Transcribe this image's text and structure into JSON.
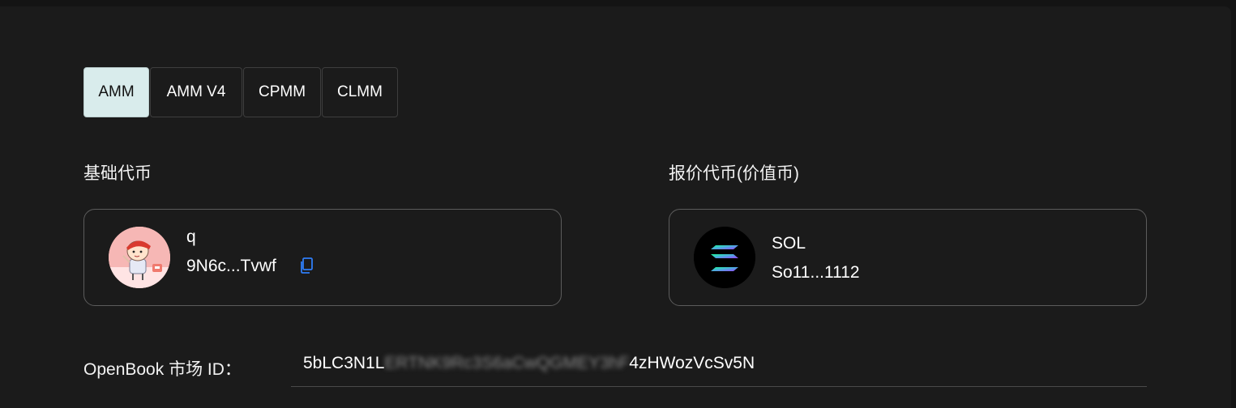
{
  "tabs": [
    {
      "label": "AMM",
      "active": true
    },
    {
      "label": "AMM V4",
      "active": false
    },
    {
      "label": "CPMM",
      "active": false
    },
    {
      "label": "CLMM",
      "active": false
    }
  ],
  "base_token": {
    "section_label": "基础代币",
    "symbol": "q",
    "address": "9N6c...Tvwf",
    "icon": "cartoon-avatar-icon"
  },
  "quote_token": {
    "section_label": "报价代币(价值币)",
    "symbol": "SOL",
    "address": "So11...1112",
    "icon": "solana-logo-icon"
  },
  "market": {
    "label": "OpenBook 市场 ID：",
    "value_prefix": "5bLC3N1L",
    "value_obscured": "ERTNK9Rc3S6aCwQGMEY3hF",
    "value_suffix": "4zHWozVcSv5N"
  },
  "colors": {
    "background": "#1b1b1b",
    "active_tab": "#d9ecec",
    "copy_icon": "#2f7df6",
    "border": "#5c5c5c"
  }
}
